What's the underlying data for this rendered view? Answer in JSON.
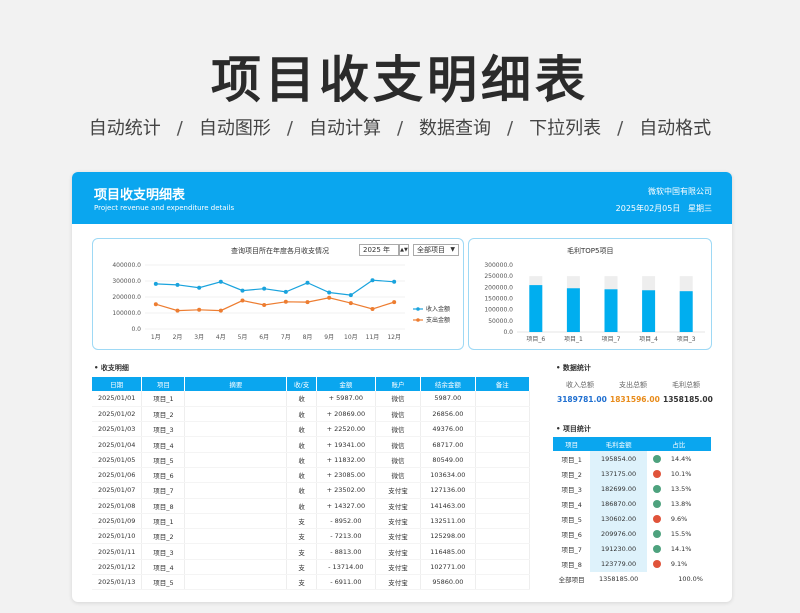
{
  "poster": {
    "title": "项目收支明细表",
    "features": [
      "自动统计",
      "自动图形",
      "自动计算",
      "数据查询",
      "下拉列表",
      "自动格式"
    ],
    "separator": "/"
  },
  "header": {
    "title": "项目收支明细表",
    "subtitle": "Project revenue and expenditure details",
    "company": "微软中国有限公司",
    "date": "2025年02月05日",
    "weekday": "星期三"
  },
  "line_panel": {
    "title": "查询项目所在年度各月收支情况",
    "year": "2025 年",
    "project_select": "全部项目",
    "legend_income": "收入金额",
    "legend_expense": "支出金额"
  },
  "bar_panel": {
    "title": "毛利TOP5项目"
  },
  "chart_data": [
    {
      "type": "line",
      "title": "查询项目所在年度各月收支情况",
      "categories": [
        "1月",
        "2月",
        "3月",
        "4月",
        "5月",
        "6月",
        "7月",
        "8月",
        "9月",
        "10月",
        "11月",
        "12月"
      ],
      "ylim": [
        0,
        400000
      ],
      "yticks": [
        "0.0",
        "100000.0",
        "200000.0",
        "300000.0",
        "400000.0"
      ],
      "legend": "right",
      "series": [
        {
          "name": "收入金额",
          "color": "#1aa3dd",
          "values": [
            282000,
            276000,
            258000,
            295000,
            240000,
            252000,
            232000,
            289000,
            228000,
            212000,
            305000,
            295000
          ]
        },
        {
          "name": "支出金额",
          "color": "#ed7d31",
          "values": [
            155000,
            115000,
            120000,
            115000,
            178000,
            150000,
            170000,
            168000,
            195000,
            162000,
            125000,
            168000
          ]
        }
      ]
    },
    {
      "type": "bar",
      "title": "毛利TOP5项目",
      "categories": [
        "项目_6",
        "项目_1",
        "项目_7",
        "项目_4",
        "项目_3"
      ],
      "ylim": [
        0,
        300000
      ],
      "yticks": [
        "0.0",
        "50000.0",
        "100000.0",
        "150000.0",
        "200000.0",
        "250000.0",
        "300000.0"
      ],
      "series": [
        {
          "name": "",
          "color": "#00aeef",
          "values": [
            209976,
            195854,
            191230,
            186870,
            182699
          ]
        }
      ],
      "background_bar_value": 250000
    }
  ],
  "detail": {
    "section_title": "收支明细",
    "columns": [
      "日期",
      "项目",
      "摘要",
      "收/支",
      "金额",
      "账户",
      "结余金额",
      "备注"
    ],
    "rows": [
      [
        "2025/01/01",
        "项目_1",
        "",
        "收",
        "+ 5987.00",
        "微信",
        "5987.00",
        ""
      ],
      [
        "2025/01/02",
        "项目_2",
        "",
        "收",
        "+ 20869.00",
        "微信",
        "26856.00",
        ""
      ],
      [
        "2025/01/03",
        "项目_3",
        "",
        "收",
        "+ 22520.00",
        "微信",
        "49376.00",
        ""
      ],
      [
        "2025/01/04",
        "项目_4",
        "",
        "收",
        "+ 19341.00",
        "微信",
        "68717.00",
        ""
      ],
      [
        "2025/01/05",
        "项目_5",
        "",
        "收",
        "+ 11832.00",
        "微信",
        "80549.00",
        ""
      ],
      [
        "2025/01/06",
        "项目_6",
        "",
        "收",
        "+ 23085.00",
        "微信",
        "103634.00",
        ""
      ],
      [
        "2025/01/07",
        "项目_7",
        "",
        "收",
        "+ 23502.00",
        "支付宝",
        "127136.00",
        ""
      ],
      [
        "2025/01/08",
        "项目_8",
        "",
        "收",
        "+ 14327.00",
        "支付宝",
        "141463.00",
        ""
      ],
      [
        "2025/01/09",
        "项目_1",
        "",
        "支",
        "- 8952.00",
        "支付宝",
        "132511.00",
        ""
      ],
      [
        "2025/01/10",
        "项目_2",
        "",
        "支",
        "- 7213.00",
        "支付宝",
        "125298.00",
        ""
      ],
      [
        "2025/01/11",
        "项目_3",
        "",
        "支",
        "- 8813.00",
        "支付宝",
        "116485.00",
        ""
      ],
      [
        "2025/01/12",
        "项目_4",
        "",
        "支",
        "- 13714.00",
        "支付宝",
        "102771.00",
        ""
      ],
      [
        "2025/01/13",
        "项目_5",
        "",
        "支",
        "- 6911.00",
        "支付宝",
        "95860.00",
        ""
      ]
    ]
  },
  "stats": {
    "section_title": "数据统计",
    "labels": [
      "收入总额",
      "支出总额",
      "毛利总额"
    ],
    "values": [
      "3189781.00",
      "1831596.00",
      "1358185.00"
    ],
    "colors": [
      "#1f6fd0",
      "#e88b1a",
      "#333333"
    ]
  },
  "project_stats": {
    "section_title": "项目统计",
    "columns": [
      "项目",
      "毛利金额",
      "占比"
    ],
    "rows": [
      {
        "name": "项目_1",
        "value": "195854.00",
        "pct": "14.4%",
        "dot": "#4ea27e"
      },
      {
        "name": "项目_2",
        "value": "137175.00",
        "pct": "10.1%",
        "dot": "#e0533a"
      },
      {
        "name": "项目_3",
        "value": "182699.00",
        "pct": "13.5%",
        "dot": "#4ea27e"
      },
      {
        "name": "项目_4",
        "value": "186870.00",
        "pct": "13.8%",
        "dot": "#4ea27e"
      },
      {
        "name": "项目_5",
        "value": "130602.00",
        "pct": "9.6%",
        "dot": "#e0533a"
      },
      {
        "name": "项目_6",
        "value": "209976.00",
        "pct": "15.5%",
        "dot": "#4ea27e"
      },
      {
        "name": "项目_7",
        "value": "191230.00",
        "pct": "14.1%",
        "dot": "#4ea27e"
      },
      {
        "name": "项目_8",
        "value": "123779.00",
        "pct": "9.1%",
        "dot": "#e0533a"
      }
    ],
    "total": {
      "name": "全部项目",
      "value": "1358185.00",
      "pct": "100.0%"
    }
  }
}
